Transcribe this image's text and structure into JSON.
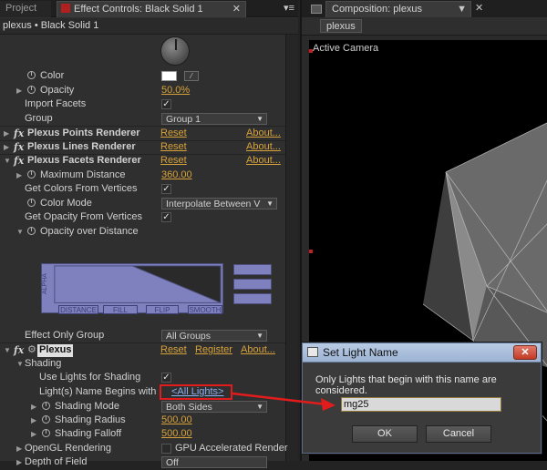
{
  "left_panel": {
    "tabs": {
      "project": "Project",
      "effect_controls": "Effect Controls: Black Solid 1"
    },
    "layer_title": "plexus • Black Solid 1",
    "rows": {
      "color": "Color",
      "opacity": "Opacity",
      "opacity_value": "50.0%",
      "import_facets": "Import Facets",
      "group": "Group",
      "group_value": "Group 1",
      "points_renderer": "Plexus Points Renderer",
      "lines_renderer": "Plexus Lines Renderer",
      "facets_renderer": "Plexus Facets Renderer",
      "reset": "Reset",
      "about": "About...",
      "max_distance": "Maximum Distance",
      "max_distance_value": "360.00",
      "get_colors": "Get Colors From Vertices",
      "color_mode": "Color Mode",
      "color_mode_value": "Interpolate Between V",
      "get_opacity": "Get Opacity From Vertices",
      "opacity_over_distance": "Opacity over Distance",
      "effect_only_group": "Effect Only Group",
      "effect_only_group_value": "All Groups",
      "plexus": "Plexus",
      "register": "Register",
      "shading": "Shading",
      "use_lights": "Use Lights for Shading",
      "lights_name": "Light(s) Name Begins with",
      "lights_name_value": "<All Lights>",
      "shading_mode": "Shading Mode",
      "shading_mode_value": "Both Sides",
      "shading_radius": "Shading Radius",
      "shading_radius_value": "500.00",
      "shading_falloff": "Shading Falloff",
      "shading_falloff_value": "500.00",
      "opengl": "OpenGL Rendering",
      "gpu": "GPU Accelerated Render",
      "depth_of_field": "Depth of Field",
      "depth_value": "Off"
    },
    "graph": {
      "side_label": "ALPHA",
      "buttons": [
        "DISTANCE",
        "FILL",
        "FLIP",
        "SMOOTH"
      ]
    }
  },
  "right_panel": {
    "tab": "Composition: plexus",
    "comp_name": "plexus",
    "viewer_label": "Active Camera"
  },
  "dialog": {
    "title": "Set Light Name",
    "message": "Only Lights that begin with this name are considered.",
    "input_value": "mg25",
    "ok": "OK",
    "cancel": "Cancel"
  },
  "colors": {
    "accent_value": "#d7a23a",
    "annotation_red": "#e21c1c",
    "graph_fill": "#7f81be"
  }
}
